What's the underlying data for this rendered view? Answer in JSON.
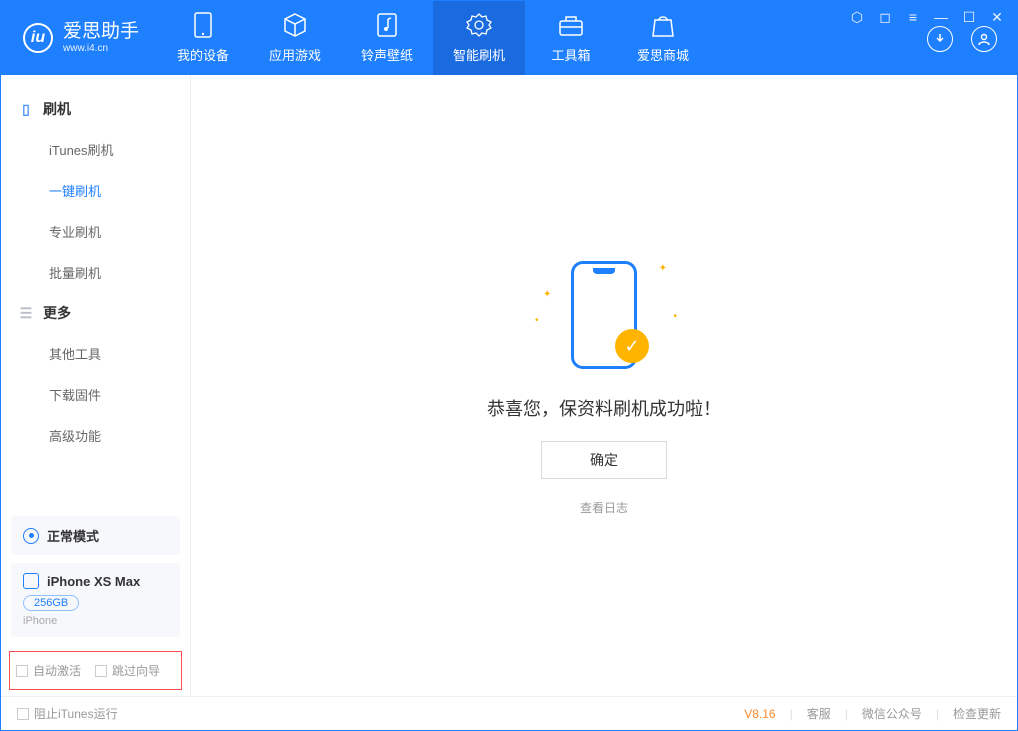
{
  "app": {
    "name_cn": "爱思助手",
    "name_en": "www.i4.cn"
  },
  "tabs": [
    {
      "label": "我的设备",
      "icon": "device-icon"
    },
    {
      "label": "应用游戏",
      "icon": "cube-icon"
    },
    {
      "label": "铃声壁纸",
      "icon": "music-icon"
    },
    {
      "label": "智能刷机",
      "icon": "gear-icon"
    },
    {
      "label": "工具箱",
      "icon": "toolbox-icon"
    },
    {
      "label": "爱思商城",
      "icon": "bag-icon"
    }
  ],
  "active_tab_index": 3,
  "sidebar": {
    "group1": {
      "title": "刷机",
      "items": [
        "iTunes刷机",
        "一键刷机",
        "专业刷机",
        "批量刷机"
      ],
      "active_index": 1
    },
    "group2": {
      "title": "更多",
      "items": [
        "其他工具",
        "下载固件",
        "高级功能"
      ]
    }
  },
  "mode_card": {
    "label": "正常模式"
  },
  "device_card": {
    "name": "iPhone XS Max",
    "storage": "256GB",
    "type": "iPhone"
  },
  "checks": {
    "auto_activate": "自动激活",
    "skip_guide": "跳过向导"
  },
  "main": {
    "message": "恭喜您，保资料刷机成功啦！",
    "ok": "确定",
    "view_log": "查看日志"
  },
  "footer": {
    "block_itunes": "阻止iTunes运行",
    "version": "V8.16",
    "support": "客服",
    "wechat": "微信公众号",
    "update": "检查更新"
  }
}
